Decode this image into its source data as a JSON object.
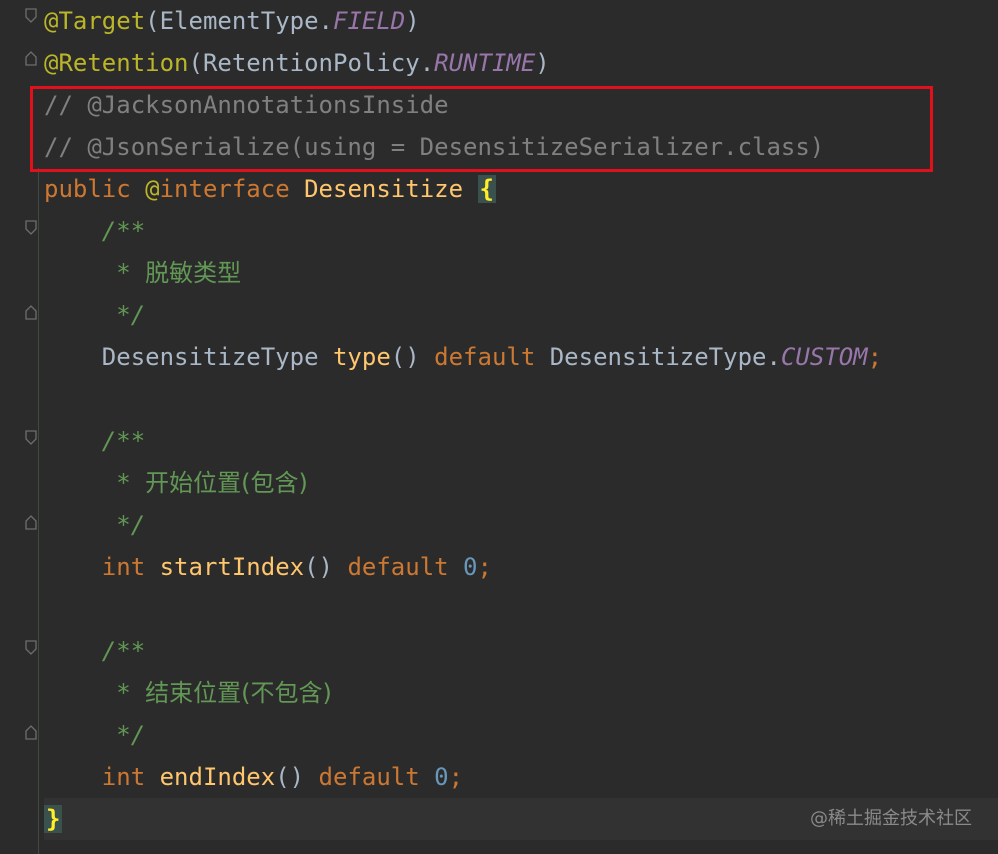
{
  "editor": {
    "lines": [
      {
        "parts": [
          {
            "t": "@Target",
            "c": "ann"
          },
          {
            "t": "(ElementType.",
            "c": "cls"
          },
          {
            "t": "FIELD",
            "c": "const"
          },
          {
            "t": ")",
            "c": "cls"
          }
        ]
      },
      {
        "parts": [
          {
            "t": "@Retention",
            "c": "ann"
          },
          {
            "t": "(RetentionPolicy.",
            "c": "cls"
          },
          {
            "t": "RUNTIME",
            "c": "const"
          },
          {
            "t": ")",
            "c": "cls"
          }
        ]
      },
      {
        "parts": [
          {
            "t": "// @JacksonAnnotationsInside",
            "c": "cmt"
          }
        ]
      },
      {
        "parts": [
          {
            "t": "// @JsonSerialize(using = DesensitizeSerializer.class)",
            "c": "cmt"
          }
        ]
      },
      {
        "parts": [
          {
            "t": "public ",
            "c": "kw"
          },
          {
            "t": "@",
            "c": "ann"
          },
          {
            "t": "interface ",
            "c": "kw"
          },
          {
            "t": "Desensitize ",
            "c": "type-name"
          },
          {
            "t": "{",
            "c": "brace-hl"
          }
        ]
      },
      {
        "parts": [
          {
            "t": "    /**",
            "c": "doc"
          }
        ]
      },
      {
        "parts": [
          {
            "t": "     * ",
            "c": "doc"
          },
          {
            "t": "脱敏类型",
            "c": "doc-cn"
          }
        ]
      },
      {
        "parts": [
          {
            "t": "     */",
            "c": "doc"
          }
        ]
      },
      {
        "parts": [
          {
            "t": "    DesensitizeType ",
            "c": "cls"
          },
          {
            "t": "type",
            "c": "method"
          },
          {
            "t": "() ",
            "c": "cls"
          },
          {
            "t": "default ",
            "c": "kw"
          },
          {
            "t": "DesensitizeType.",
            "c": "cls"
          },
          {
            "t": "CUSTOM",
            "c": "const"
          },
          {
            "t": ";",
            "c": "kw"
          }
        ]
      },
      {
        "parts": []
      },
      {
        "parts": [
          {
            "t": "    /**",
            "c": "doc"
          }
        ]
      },
      {
        "parts": [
          {
            "t": "     * ",
            "c": "doc"
          },
          {
            "t": "开始位置(包含)",
            "c": "doc-cn"
          }
        ]
      },
      {
        "parts": [
          {
            "t": "     */",
            "c": "doc"
          }
        ]
      },
      {
        "parts": [
          {
            "t": "    ",
            "c": "cls"
          },
          {
            "t": "int ",
            "c": "kw"
          },
          {
            "t": "startIndex",
            "c": "method"
          },
          {
            "t": "() ",
            "c": "cls"
          },
          {
            "t": "default ",
            "c": "kw"
          },
          {
            "t": "0",
            "c": "num"
          },
          {
            "t": ";",
            "c": "kw"
          }
        ]
      },
      {
        "parts": []
      },
      {
        "parts": [
          {
            "t": "    /**",
            "c": "doc"
          }
        ]
      },
      {
        "parts": [
          {
            "t": "     * ",
            "c": "doc"
          },
          {
            "t": "结束位置(不包含)",
            "c": "doc-cn"
          }
        ]
      },
      {
        "parts": [
          {
            "t": "     */",
            "c": "doc"
          }
        ]
      },
      {
        "parts": [
          {
            "t": "    ",
            "c": "cls"
          },
          {
            "t": "int ",
            "c": "kw"
          },
          {
            "t": "endIndex",
            "c": "method"
          },
          {
            "t": "() ",
            "c": "cls"
          },
          {
            "t": "default ",
            "c": "kw"
          },
          {
            "t": "0",
            "c": "num"
          },
          {
            "t": ";",
            "c": "kw"
          }
        ]
      },
      {
        "parts": [
          {
            "t": "}",
            "c": "brace-hl"
          }
        ]
      }
    ]
  },
  "watermark": "@稀土掘金技术社区",
  "colors": {
    "background": "#2b2b2b",
    "annotation": "#bbb529",
    "keyword": "#cc7832",
    "constant": "#9876aa",
    "comment": "#808080",
    "doc_comment": "#629755",
    "method": "#ffc66d",
    "number": "#6897bb",
    "highlight_box": "#e0101c"
  }
}
